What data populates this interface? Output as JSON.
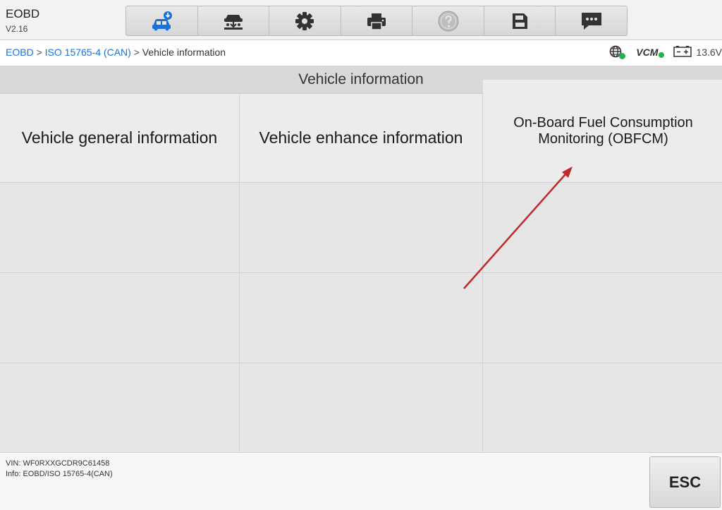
{
  "app": {
    "name": "EOBD",
    "version": "V2.16"
  },
  "toolbar": {
    "buttons": [
      {
        "icon": "car-diagnostics-icon",
        "color": "#1a73d9"
      },
      {
        "icon": "car-lift-icon"
      },
      {
        "icon": "gear-icon"
      },
      {
        "icon": "printer-icon"
      },
      {
        "icon": "help-icon",
        "state": "disabled"
      },
      {
        "icon": "save-icon"
      },
      {
        "icon": "message-icon"
      }
    ]
  },
  "breadcrumb": {
    "items": [
      "EOBD",
      "ISO 15765-4 (CAN)"
    ],
    "separator": " > ",
    "current": "Vehicle information"
  },
  "status": {
    "network_icon": "globe-icon",
    "vcm_label": "VCM",
    "battery_voltage": "13.6V",
    "ok_color": "#22b14c"
  },
  "section": {
    "title": "Vehicle information"
  },
  "menu": {
    "items": [
      "Vehicle general information",
      "Vehicle enhance information",
      "On-Board Fuel Consumption Monitoring (OBFCM)"
    ]
  },
  "annotation": {
    "arrow_color": "#c0282d"
  },
  "footer": {
    "vin": "VIN: WF0RXXGCDR9C61458",
    "info": "Info: EOBD/ISO 15765-4(CAN)",
    "esc_label": "ESC"
  }
}
